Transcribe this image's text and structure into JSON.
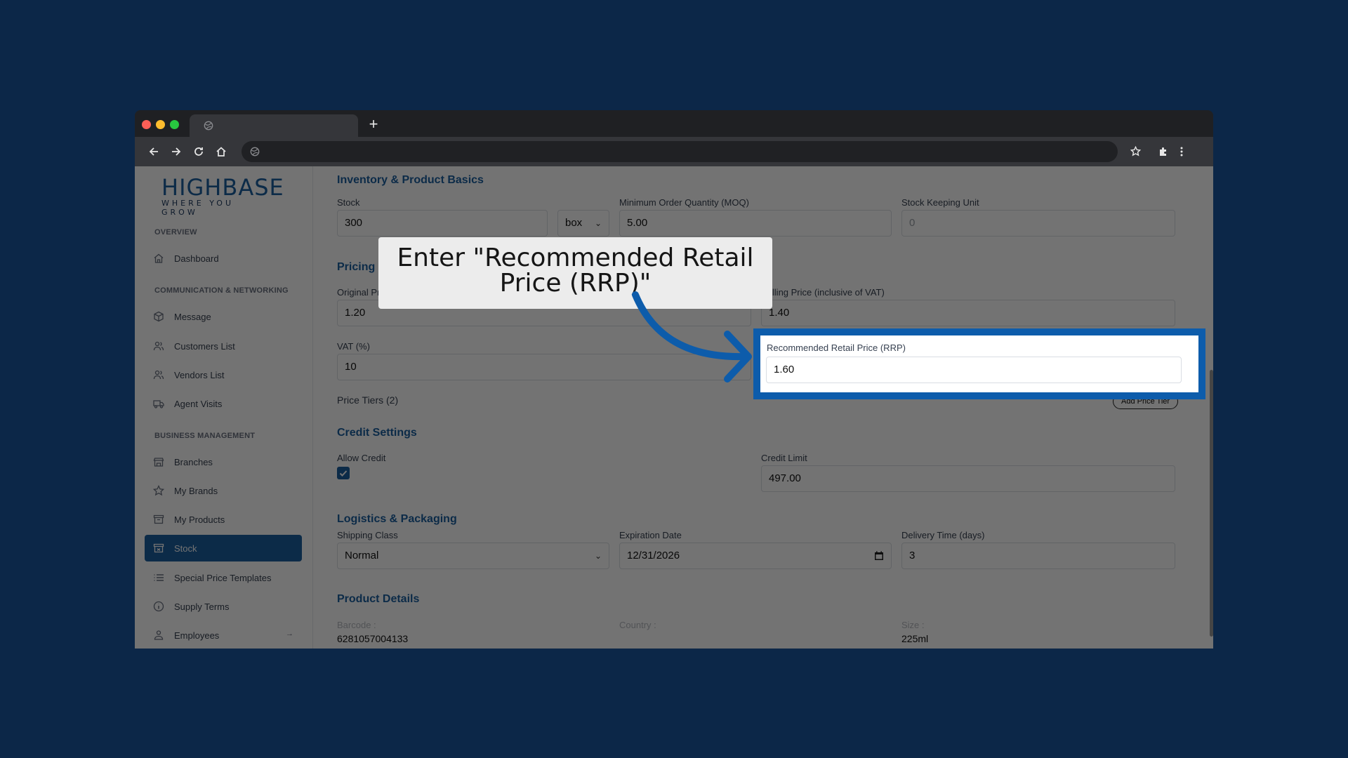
{
  "browser": {
    "tab_title": "",
    "url": "",
    "new_tab": "+"
  },
  "sidebar": {
    "logo_main": "HIGHBASE",
    "logo_tagline": "WHERE YOU GROW",
    "sections": [
      {
        "title": "OVERVIEW"
      },
      {
        "title": "COMMUNICATION & NETWORKING"
      },
      {
        "title": "BUSINESS MANAGEMENT"
      }
    ],
    "items": [
      {
        "label": "Dashboard",
        "icon": "home-icon"
      },
      {
        "label": "Message",
        "icon": "box-icon"
      },
      {
        "label": "Customers List",
        "icon": "users-icon"
      },
      {
        "label": "Vendors List",
        "icon": "users-icon"
      },
      {
        "label": "Agent Visits",
        "icon": "truck-icon"
      },
      {
        "label": "Branches",
        "icon": "building-icon"
      },
      {
        "label": "My Brands",
        "icon": "star-icon"
      },
      {
        "label": "My Products",
        "icon": "archive-icon"
      },
      {
        "label": "Stock",
        "icon": "archive-icon",
        "active": true
      },
      {
        "label": "Special Price Templates",
        "icon": "list-icon"
      },
      {
        "label": "Supply Terms",
        "icon": "info-icon"
      },
      {
        "label": "Employees",
        "icon": "employees-icon",
        "arrow": "→"
      }
    ]
  },
  "form": {
    "inventory": {
      "heading": "Inventory & Product Basics",
      "stock_label": "Stock",
      "stock_value": "300",
      "unit_value": "box",
      "moq_label": "Minimum Order Quantity (MOQ)",
      "moq_value": "5.00",
      "sku_label": "Stock Keeping Unit",
      "sku_placeholder": "0"
    },
    "pricing": {
      "heading": "Pricing & Tax",
      "original_label": "Original Price (inclusive of VAT)",
      "original_value": "1.20",
      "selling_label": "Selling Price (inclusive of VAT)",
      "selling_value": "1.40",
      "vat_label": "VAT (%)",
      "vat_value": "10",
      "rrp_label": "Recommended Retail Price (RRP)",
      "rrp_value": "1.60",
      "price_tiers": "Price Tiers (2)",
      "add_tier": "Add Price Tier"
    },
    "credit": {
      "heading": "Credit Settings",
      "allow_label": "Allow Credit",
      "allow_checked": true,
      "limit_label": "Credit Limit",
      "limit_value": "497.00"
    },
    "logistics": {
      "heading": "Logistics & Packaging",
      "shipping_label": "Shipping Class",
      "shipping_value": "Normal",
      "expiration_label": "Expiration Date",
      "expiration_value": "12/31/2026",
      "delivery_label": "Delivery Time (days)",
      "delivery_value": "3"
    },
    "details": {
      "heading": "Product Details",
      "barcode_label": "Barcode :",
      "barcode_value": "6281057004133",
      "country_label": "Country :",
      "size_label": "Size :",
      "size_value": "225ml"
    }
  },
  "callout": {
    "text_line1": "Enter \"Recommended Retail",
    "text_line2": "Price (RRP)\""
  },
  "colors": {
    "page_bg": "#0c2748",
    "brand_blue": "#1b5fa0",
    "highlight": "#0d5cab"
  }
}
